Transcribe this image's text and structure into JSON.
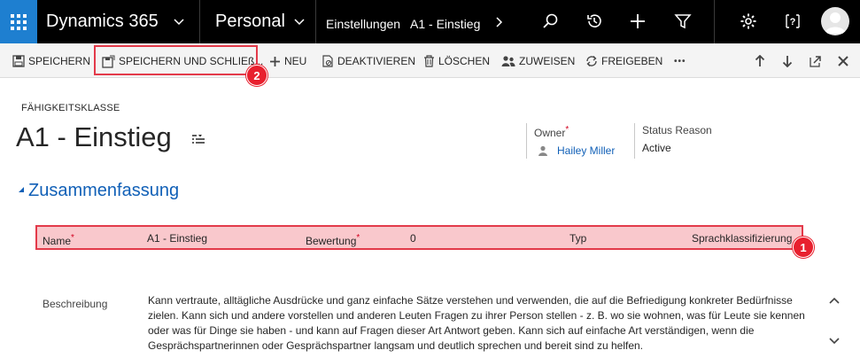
{
  "nav": {
    "app_name": "Dynamics 365",
    "area": "Personal",
    "breadcrumb": [
      "Einstellungen",
      "A1 - Einstieg"
    ]
  },
  "commands": {
    "save": "SPEICHERN",
    "save_close": "SPEICHERN UND SCHLIEß...",
    "new": "NEU",
    "deactivate": "DEAKTIVIEREN",
    "delete": "LÖSCHEN",
    "assign": "ZUWEISEN",
    "share": "FREIGEBEN",
    "more": "•••"
  },
  "header": {
    "entity_type": "FÄHIGKEITSKLASSE",
    "title": "A1 - Einstieg",
    "owner_label": "Owner",
    "owner_required": "*",
    "owner_value": "Hailey Miller",
    "status_label": "Status Reason",
    "status_value": "Active"
  },
  "section": {
    "title": "Zusammenfassung",
    "fields": {
      "name_label": "Name",
      "name_value": "A1 - Einstieg",
      "rating_label": "Bewertung",
      "rating_value": "0",
      "type_label": "Typ",
      "type_value": "Sprachklassifizierung",
      "required_marker": "*"
    },
    "description_label": "Beschreibung",
    "description_value": "Kann vertraute, alltägliche Ausdrücke und ganz einfache Sätze verstehen und verwenden, die auf die Befriedigung konkreter Bedürfnisse zielen. Kann sich und andere vorstellen und anderen Leuten Fragen zu ihrer Person stellen - z. B. wo sie wohnen, was für Leute sie kennen oder was für Dinge sie haben - und kann auf Fragen dieser Art Antwort geben. Kann sich auf einfache Art verständigen, wenn die Gesprächspartnerinnen oder Gesprächspartner langsam und deutlich sprechen und bereit sind zu helfen."
  },
  "callouts": {
    "one": "1",
    "two": "2"
  },
  "colors": {
    "nav_bg": "#000000",
    "waffle_bg": "#1e7fd0",
    "accent_link": "#1160b7",
    "highlight_border": "#e33a4a",
    "highlight_fill": "#f9c8cc",
    "badge": "#e8202e"
  }
}
